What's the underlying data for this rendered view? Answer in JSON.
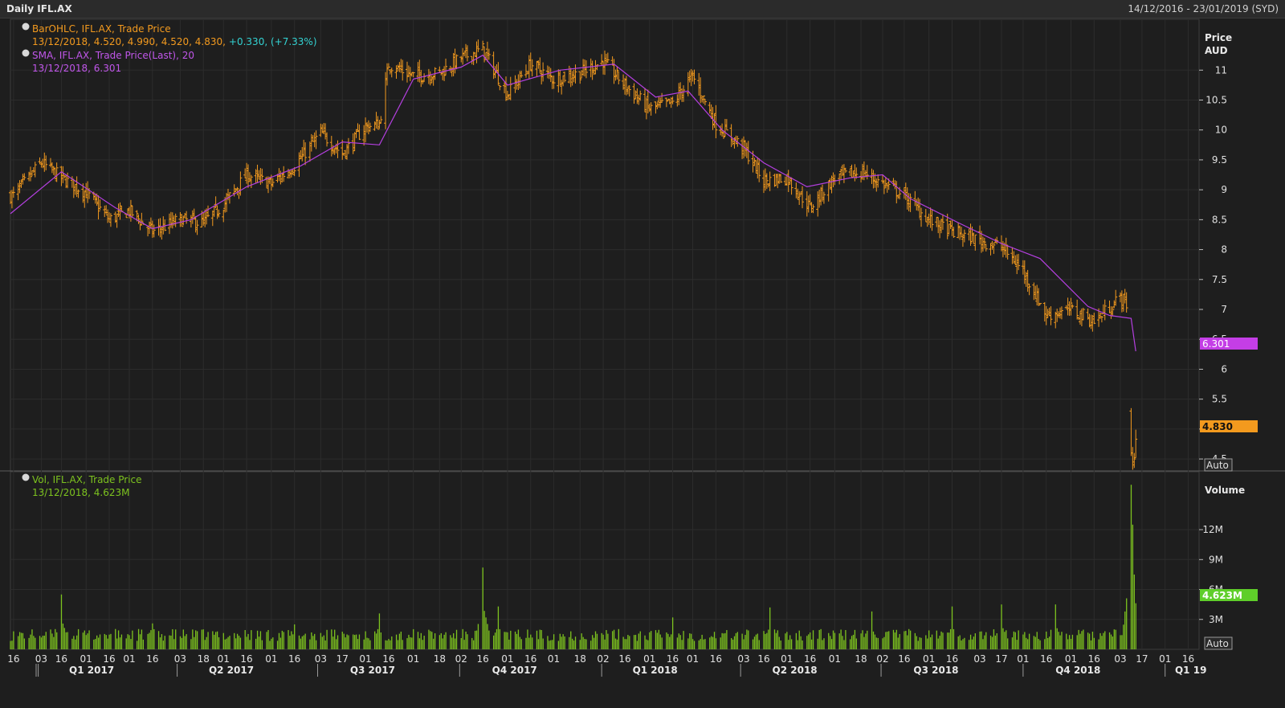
{
  "header": {
    "title": "Daily IFL.AX",
    "range": "14/12/2016 - 23/01/2019 (SYD)"
  },
  "colors": {
    "bar": "#f39a1e",
    "sma": "#b43fe0",
    "vol": "#7dc31f",
    "change": "#33d3d3",
    "bg": "#1e1e1e",
    "grid": "#2c2c2c"
  },
  "legend": {
    "price_line1": "BarOHLC, IFL.AX, Trade Price",
    "price_line2": "13/12/2018, 4.520, 4.990, 4.520, 4.830,",
    "price_change": "+0.330, (+7.33%)",
    "sma_line1": "SMA, IFL.AX, Trade Price(Last),  20",
    "sma_line2": "13/12/2018, 6.301",
    "vol_line1": "Vol, IFL.AX, Trade Price",
    "vol_line2": "13/12/2018, 4.623M"
  },
  "axis": {
    "price_title": "Price",
    "price_unit": "AUD",
    "price_ticks": [
      "11",
      "10.5",
      "10",
      "9.5",
      "9",
      "8.5",
      "8",
      "7.5",
      "7",
      "6.5",
      "6",
      "5.5",
      "5",
      "4.5"
    ],
    "price_tick_values": [
      11,
      10.5,
      10,
      9.5,
      9,
      8.5,
      8,
      7.5,
      7,
      6.5,
      6,
      5.5,
      5,
      4.5
    ],
    "price_range": [
      4.3,
      11.85
    ],
    "volume_title": "Volume",
    "volume_ticks": [
      "12M",
      "9M",
      "6M",
      "3M"
    ],
    "volume_tick_values": [
      12,
      9,
      6,
      3
    ],
    "volume_range": [
      0,
      17
    ],
    "auto_label": "Auto",
    "sma_badge": "6.301",
    "price_badge": "4.830",
    "volume_badge": "4.623M",
    "day_ticks": [
      "16",
      "03",
      "16",
      "01",
      "16",
      "01",
      "16",
      "03",
      "18",
      "03",
      "16",
      "01",
      "16",
      "03",
      "17",
      "01",
      "16",
      "01",
      "18",
      "02",
      "16",
      "01",
      "16",
      "01",
      "16",
      "01",
      "16",
      "01",
      "16",
      "02",
      "16",
      "01",
      "16",
      "01",
      "16",
      "03",
      "16",
      "01",
      "16",
      "03",
      "16",
      "01",
      "18",
      "02",
      "16",
      "01",
      "16",
      "03",
      "17",
      "01",
      "16",
      "01",
      "16",
      "03",
      "17",
      "01",
      "16"
    ],
    "quarter_ticks": [
      "Q1 2017",
      "Q2 2017",
      "Q3 2017",
      "Q4 2017",
      "Q1 2018",
      "Q2 2018",
      "Q3 2018",
      "Q4 2018",
      "Q1 19"
    ]
  },
  "chart_data": [
    {
      "type": "line",
      "series": [
        {
          "name": "BarOHLC, IFL.AX, Trade Price",
          "kind": "ohlc-close",
          "x": [
            "2016-12-16",
            "2017-01-03",
            "2017-01-16",
            "2017-02-01",
            "2017-02-16",
            "2017-03-01",
            "2017-03-16",
            "2017-04-03",
            "2017-04-18",
            "2017-05-01",
            "2017-05-16",
            "2017-06-01",
            "2017-06-16",
            "2017-07-03",
            "2017-07-17",
            "2017-08-01",
            "2017-08-10",
            "2017-08-16",
            "2017-09-01",
            "2017-09-18",
            "2017-10-02",
            "2017-10-16",
            "2017-11-01",
            "2017-11-16",
            "2017-12-01",
            "2017-12-18",
            "2018-01-02",
            "2018-01-16",
            "2018-02-01",
            "2018-02-16",
            "2018-03-01",
            "2018-03-16",
            "2018-04-03",
            "2018-04-16",
            "2018-05-01",
            "2018-05-16",
            "2018-06-01",
            "2018-06-18",
            "2018-07-02",
            "2018-07-16",
            "2018-08-01",
            "2018-08-16",
            "2018-09-03",
            "2018-09-17",
            "2018-10-01",
            "2018-10-16",
            "2018-11-01",
            "2018-11-16",
            "2018-12-03",
            "2018-12-07",
            "2018-12-10",
            "2018-12-13"
          ],
          "y": [
            8.9,
            9.45,
            9.2,
            8.95,
            8.5,
            8.65,
            8.3,
            8.5,
            8.45,
            8.75,
            9.25,
            9.1,
            9.4,
            9.95,
            9.6,
            10.05,
            10.1,
            11.1,
            10.9,
            10.95,
            11.2,
            11.35,
            10.6,
            11.1,
            10.85,
            10.95,
            11.15,
            10.75,
            10.35,
            10.45,
            10.9,
            10.1,
            9.7,
            9.15,
            9.2,
            8.7,
            9.2,
            9.3,
            9.1,
            8.9,
            8.5,
            8.3,
            8.15,
            8.05,
            7.65,
            6.9,
            7.0,
            6.8,
            7.2,
            7.1,
            4.45,
            4.83
          ]
        },
        {
          "name": "SMA, IFL.AX, Trade Price(Last),  20",
          "x": [
            "2016-12-14",
            "2017-01-16",
            "2017-02-20",
            "2017-03-16",
            "2017-04-10",
            "2017-05-16",
            "2017-06-20",
            "2017-07-17",
            "2017-08-10",
            "2017-09-01",
            "2017-10-02",
            "2017-10-16",
            "2017-11-01",
            "2017-12-05",
            "2018-01-09",
            "2018-02-05",
            "2018-02-26",
            "2018-03-20",
            "2018-04-16",
            "2018-05-14",
            "2018-06-11",
            "2018-07-02",
            "2018-07-20",
            "2018-08-20",
            "2018-09-17",
            "2018-10-12",
            "2018-11-12",
            "2018-11-26",
            "2018-12-10",
            "2018-12-13"
          ],
          "y": [
            8.6,
            9.3,
            8.7,
            8.35,
            8.5,
            9.05,
            9.4,
            9.8,
            9.75,
            10.85,
            11.05,
            11.25,
            10.75,
            11.0,
            11.1,
            10.55,
            10.65,
            10.0,
            9.45,
            9.05,
            9.2,
            9.25,
            8.85,
            8.45,
            8.1,
            7.85,
            7.05,
            6.9,
            6.85,
            6.301
          ]
        }
      ],
      "ylabel": "Price AUD",
      "ylim": [
        4.3,
        11.85
      ],
      "xlim": [
        "2016-12-14",
        "2019-01-23"
      ],
      "grid": true
    },
    {
      "type": "bar",
      "series": [
        {
          "name": "Vol, IFL.AX, Trade Price",
          "x": [
            "2017-01-16",
            "2017-03-16",
            "2017-06-16",
            "2017-08-10",
            "2017-10-16",
            "2017-10-26",
            "2018-02-16",
            "2018-04-20",
            "2018-06-25",
            "2018-08-16",
            "2018-09-17",
            "2018-10-22",
            "2018-12-10",
            "2018-12-11",
            "2018-12-12",
            "2018-12-13"
          ],
          "y": [
            5.5,
            2.6,
            2.5,
            3.6,
            8.2,
            4.3,
            3.2,
            4.2,
            3.8,
            4.3,
            4.5,
            4.5,
            16.5,
            12.5,
            7.5,
            4.623
          ]
        }
      ],
      "baseline_volume_M": 1.2,
      "ylabel": "Volume",
      "ylim": [
        0,
        17
      ],
      "grid": true
    }
  ]
}
